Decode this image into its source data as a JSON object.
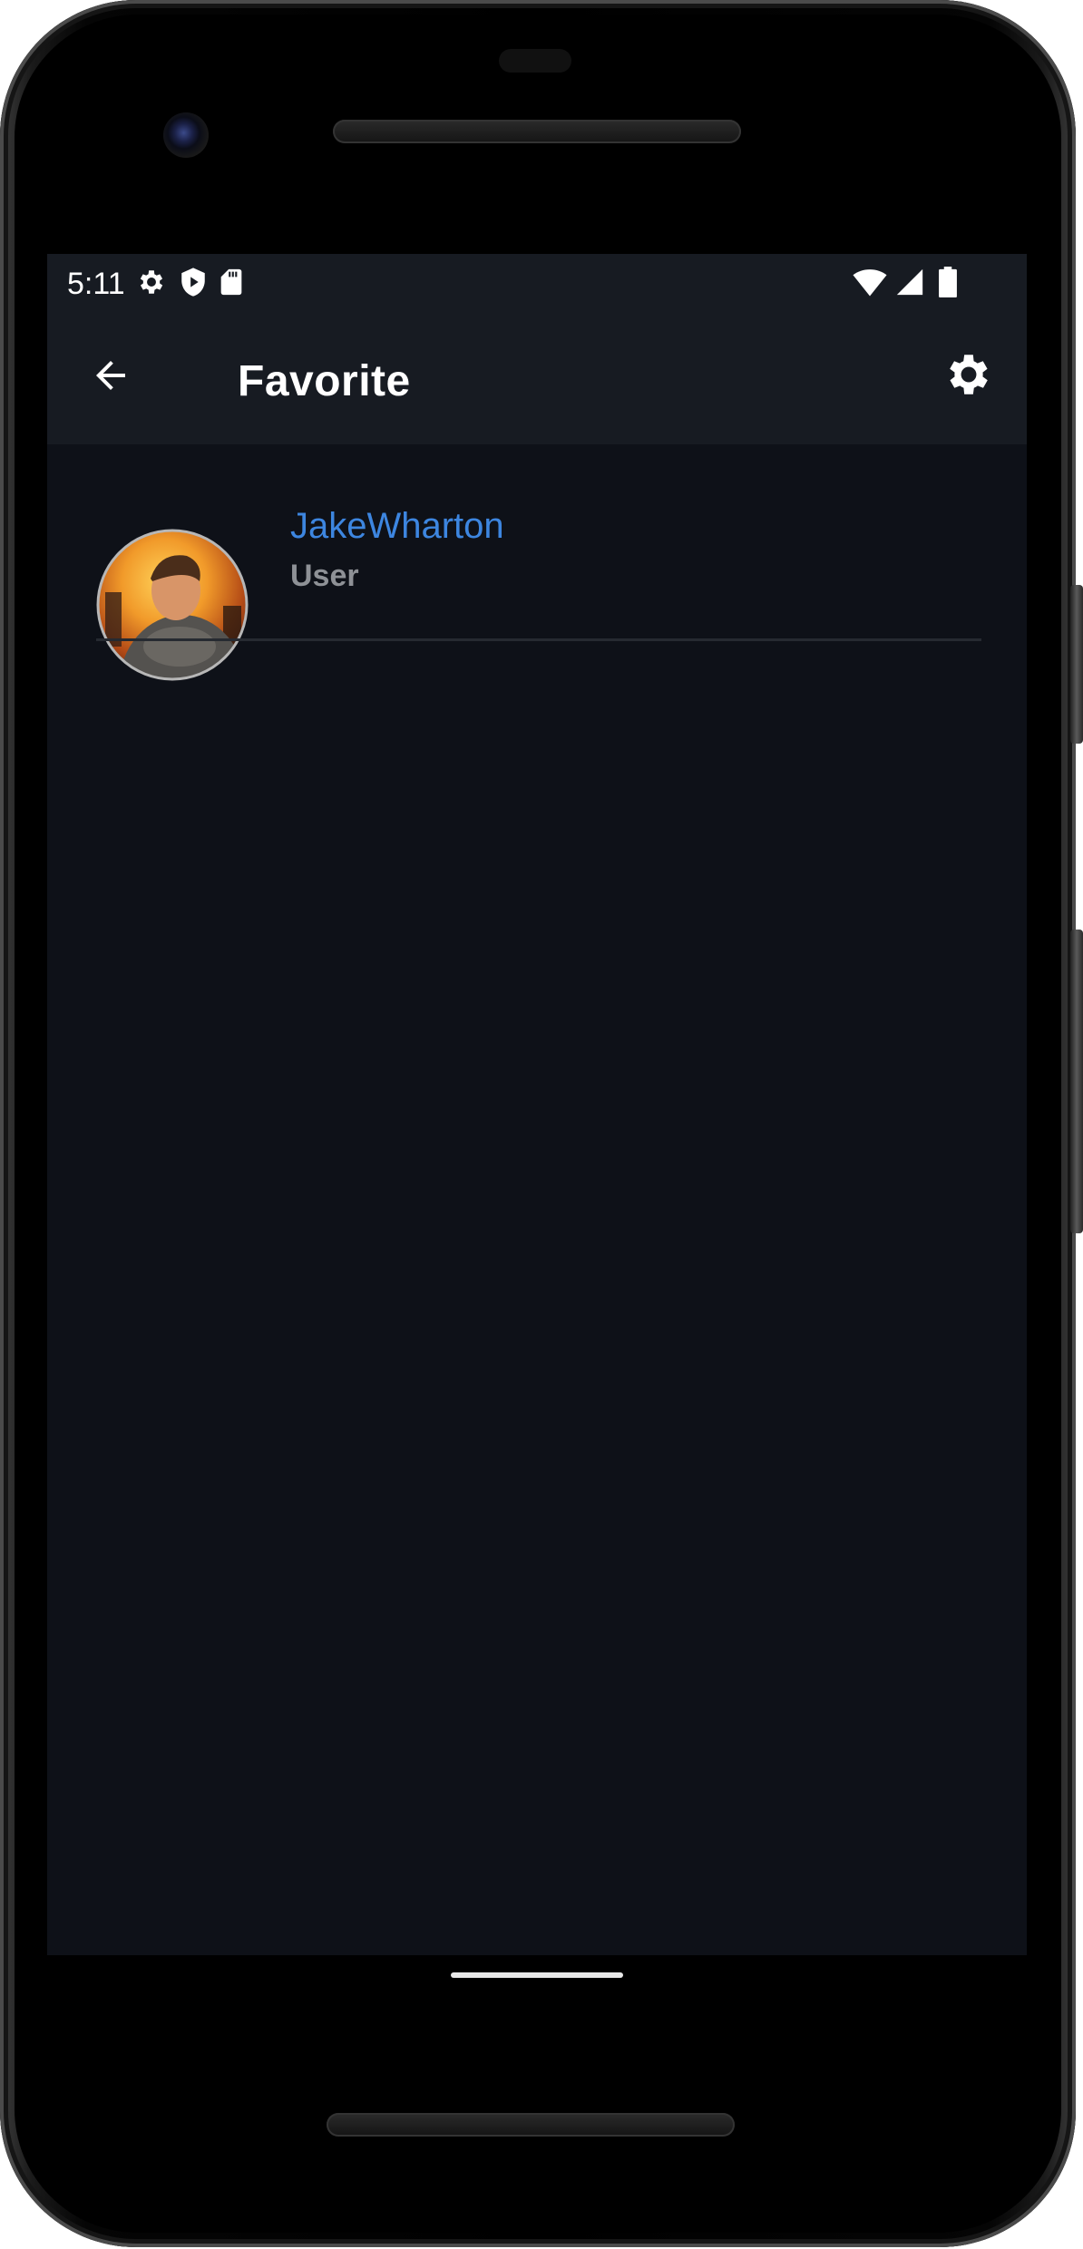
{
  "status_bar": {
    "time": "5:11",
    "left_icons": [
      "gear-icon",
      "shield-play-icon",
      "sd-card-icon"
    ],
    "right_icons": [
      "wifi-icon",
      "cell-signal-icon",
      "battery-icon"
    ]
  },
  "app_bar": {
    "title": "Favorite",
    "back_icon": "arrow-left-icon",
    "settings_icon": "gear-icon"
  },
  "favorites": [
    {
      "name": "JakeWharton",
      "type": "User",
      "avatar": "avatar-photo"
    }
  ],
  "colors": {
    "bar_background": "#171b22",
    "screen_background": "#0e1118",
    "link_blue": "#3d86e0",
    "subtitle_gray": "#8e9196",
    "divider": "#262a31"
  }
}
